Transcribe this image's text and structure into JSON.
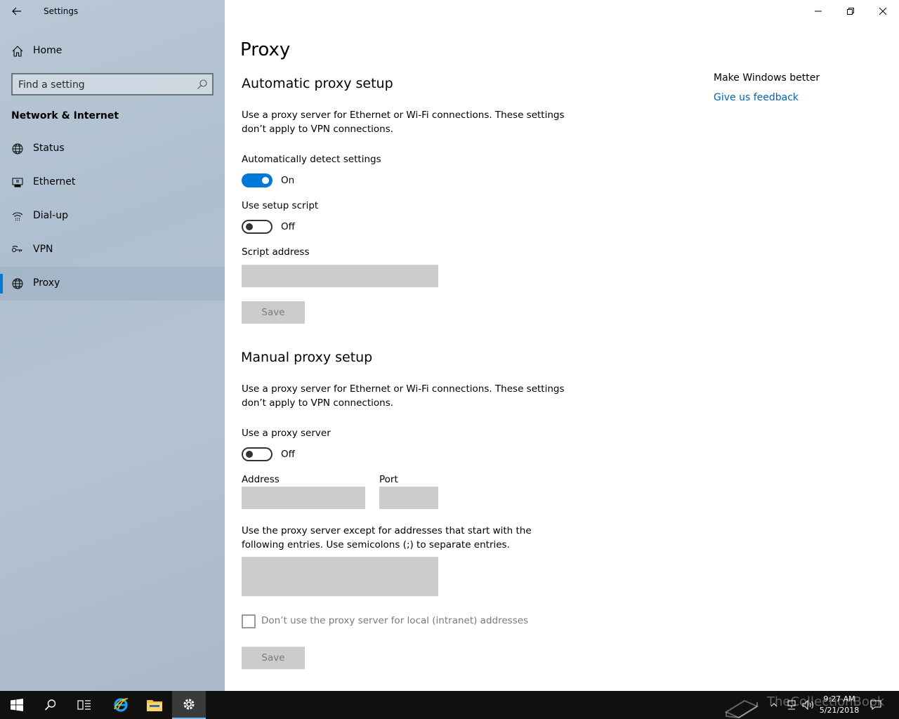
{
  "window": {
    "title": "Settings"
  },
  "sidebar": {
    "home_label": "Home",
    "search_placeholder": "Find a setting",
    "section_title": "Network & Internet",
    "items": [
      {
        "label": "Status",
        "icon": "globe-status-icon"
      },
      {
        "label": "Ethernet",
        "icon": "ethernet-icon"
      },
      {
        "label": "Dial-up",
        "icon": "dialup-icon"
      },
      {
        "label": "VPN",
        "icon": "vpn-icon"
      },
      {
        "label": "Proxy",
        "icon": "globe-icon",
        "selected": true
      }
    ]
  },
  "main": {
    "title": "Proxy",
    "auto": {
      "heading": "Automatic proxy setup",
      "description": "Use a proxy server for Ethernet or Wi-Fi connections. These settings don’t apply to VPN connections.",
      "detect_label": "Automatically detect settings",
      "detect_state": "On",
      "script_label": "Use setup script",
      "script_state": "Off",
      "script_address_label": "Script address",
      "script_address_value": "",
      "save_label": "Save"
    },
    "manual": {
      "heading": "Manual proxy setup",
      "description": "Use a proxy server for Ethernet or Wi-Fi connections. These settings don’t apply to VPN connections.",
      "use_proxy_label": "Use a proxy server",
      "use_proxy_state": "Off",
      "address_label": "Address",
      "address_value": "",
      "port_label": "Port",
      "port_value": "",
      "exceptions_description": "Use the proxy server except for addresses that start with the following entries. Use semicolons (;) to separate entries.",
      "exceptions_value": "",
      "local_checkbox_label": "Don’t use the proxy server for local (intranet) addresses",
      "save_label": "Save"
    },
    "side": {
      "heading": "Make Windows better",
      "link": "Give us feedback"
    }
  },
  "taskbar": {
    "time": "9:27 AM",
    "date": "5/21/2018",
    "watermark": "TheCollectionBook",
    "accent_color": "#0078d7"
  }
}
